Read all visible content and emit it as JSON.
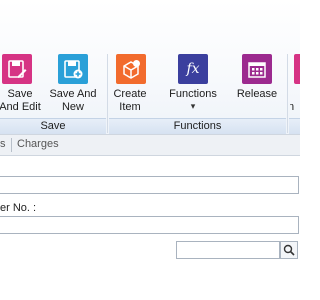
{
  "ribbon": {
    "buttons": {
      "save_and_edit": {
        "label": "Save\nAnd Edit",
        "icon": "save-edit-icon",
        "color": "#d63384"
      },
      "save_and_new": {
        "label": "Save And\nNew",
        "icon": "save-new-icon",
        "color": "#2aa0d8"
      },
      "create_item": {
        "label": "Create\nItem",
        "icon": "create-item-icon",
        "color": "#f26b2d"
      },
      "functions": {
        "label": "Functions",
        "icon": "fx-icon",
        "color": "#3b3f9e",
        "caret": "▾"
      },
      "release": {
        "label": "Release",
        "icon": "calendar-icon",
        "color": "#9c2a8f"
      },
      "partial": {
        "label": "n",
        "icon": "partial-icon",
        "color": "#d63384"
      }
    },
    "groups": {
      "save": "Save",
      "functions": "Functions"
    }
  },
  "tabs": {
    "partial_tab": "s",
    "charges": "Charges"
  },
  "form": {
    "partial_label": "er No. :",
    "field_1_value": "",
    "field_2_value": "",
    "search_value": ""
  }
}
